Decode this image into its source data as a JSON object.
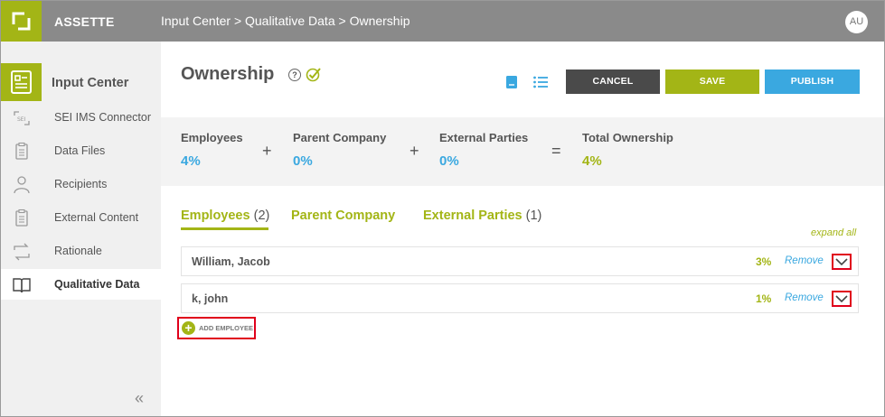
{
  "app": {
    "brand": "ASSETTE",
    "breadcrumb": "Input Center > Qualitative Data > Ownership",
    "avatar_initials": "AU"
  },
  "sidebar": {
    "header": "Input Center",
    "items": [
      {
        "label": "SEI IMS Connector",
        "icon": "sei-connector-icon"
      },
      {
        "label": "Data Files",
        "icon": "data-files-icon"
      },
      {
        "label": "Recipients",
        "icon": "recipients-icon"
      },
      {
        "label": "External Content",
        "icon": "external-content-icon"
      },
      {
        "label": "Rationale",
        "icon": "rationale-icon"
      },
      {
        "label": "Qualitative Data",
        "icon": "book-icon",
        "active": true
      }
    ],
    "collapse_glyph": "«"
  },
  "page": {
    "title": "Ownership",
    "help_glyph": "?"
  },
  "toolbar": {
    "cancel": "CANCEL",
    "save": "SAVE",
    "publish": "PUBLISH"
  },
  "summary": {
    "employees_label": "Employees",
    "employees_value": "4%",
    "parent_label": "Parent Company",
    "parent_value": "0%",
    "external_label": "External Parties",
    "external_value": "0%",
    "total_label": "Total Ownership",
    "total_value": "4%",
    "plus": "+",
    "equals": "="
  },
  "tabs": [
    {
      "label": "Employees",
      "count": "(2)"
    },
    {
      "label": "Parent Company",
      "count": ""
    },
    {
      "label": "External Parties",
      "count": "(1)"
    }
  ],
  "expand_all": "expand all",
  "employees": [
    {
      "name": "William, Jacob",
      "pct": "3%",
      "remove": "Remove"
    },
    {
      "name": "k, john",
      "pct": "1%",
      "remove": "Remove"
    }
  ],
  "add_employee": "ADD EMPLOYEE",
  "colors": {
    "accent": "#a3b516",
    "blue": "#3aa8e0",
    "dark": "#4a4a4a",
    "highlight": "#e0001b"
  }
}
